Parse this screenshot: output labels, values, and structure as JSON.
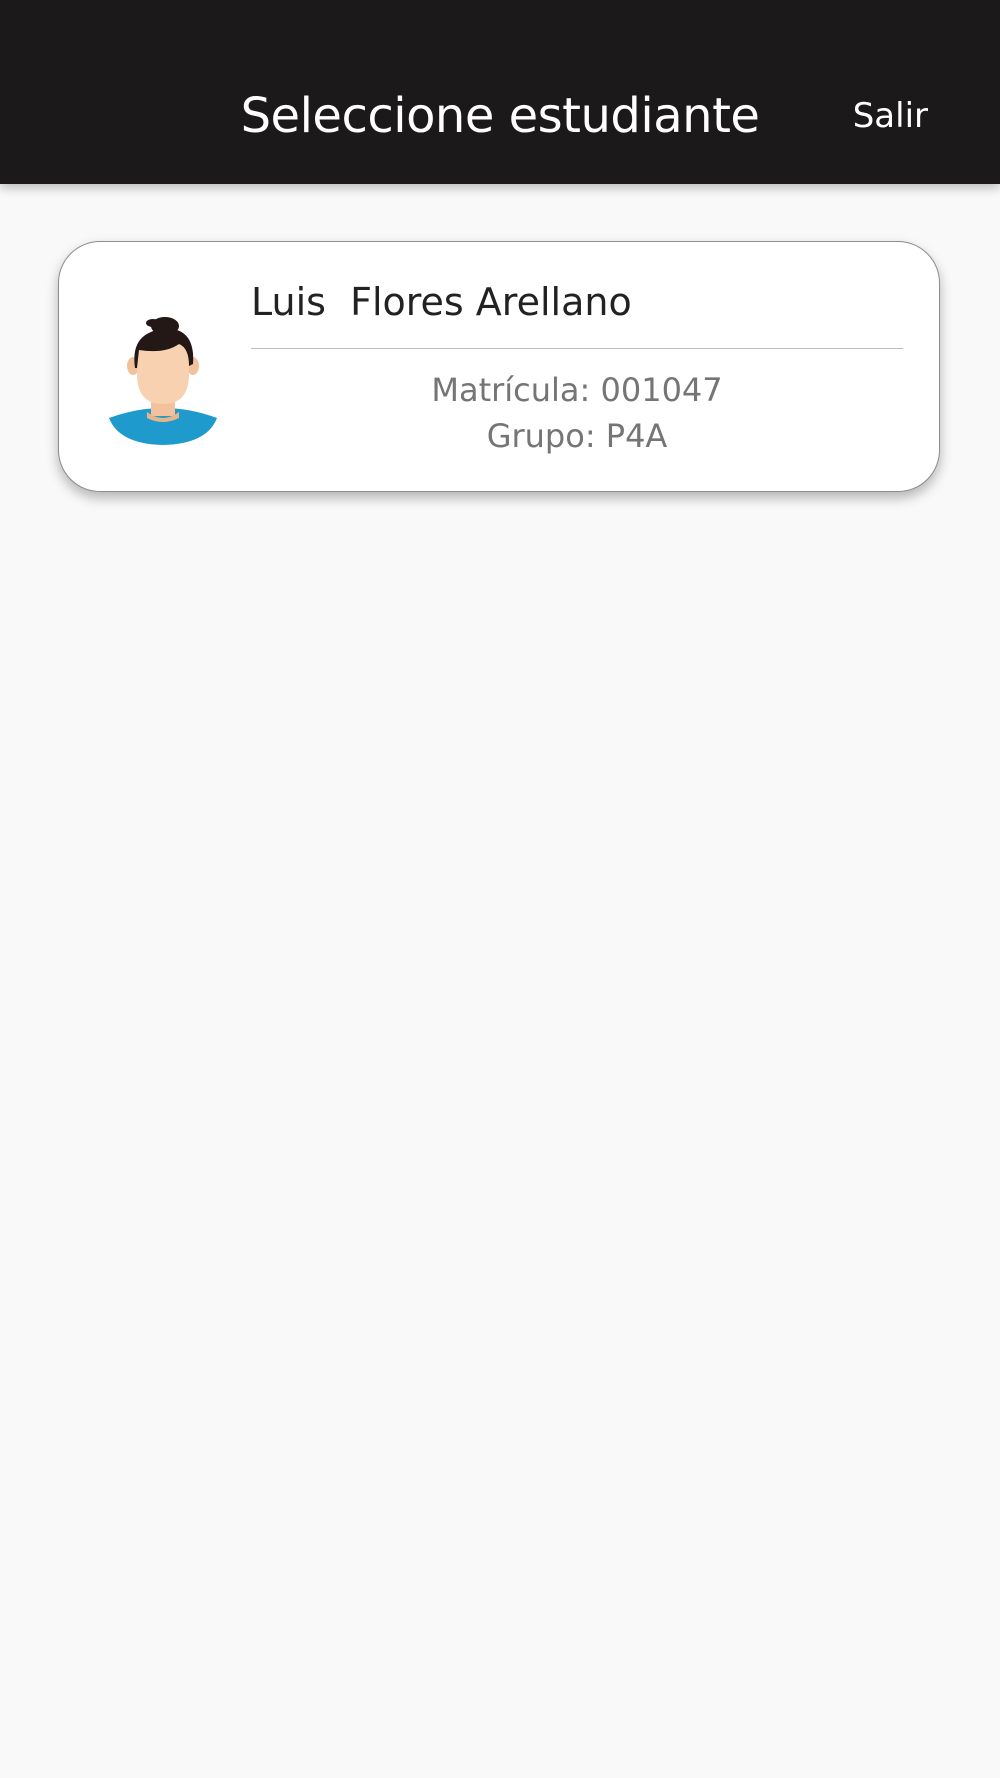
{
  "header": {
    "title": "Seleccione estudiante",
    "exit_label": "Salir"
  },
  "students": [
    {
      "name": "Luis  Flores Arellano",
      "matricula": "Matrícula: 001047",
      "grupo": "Grupo: P4A",
      "avatar_icon": "student-avatar-icon"
    }
  ],
  "colors": {
    "app_bar": "#1c191a",
    "background": "#f9f9f9",
    "card": "#ffffff",
    "avatar_shirt": "#1e9bcc",
    "avatar_skin": "#f8d1b0",
    "avatar_hair": "#231815"
  }
}
